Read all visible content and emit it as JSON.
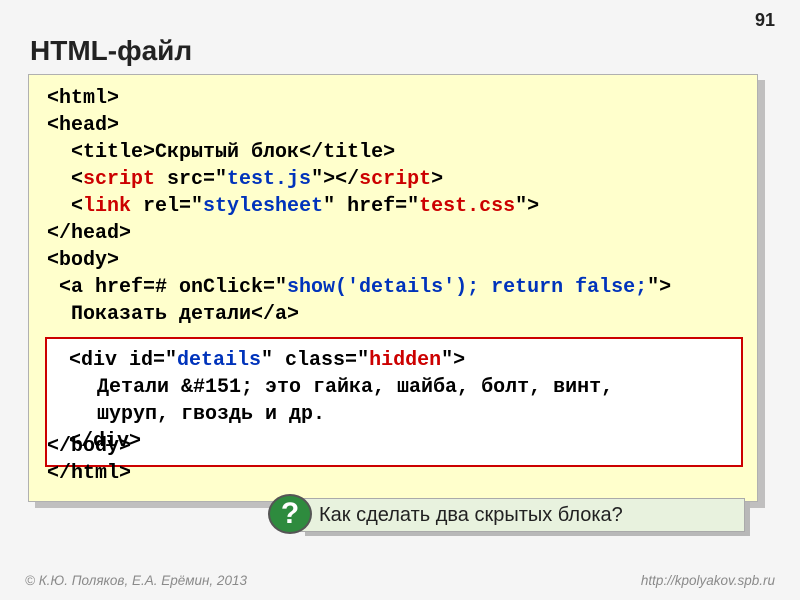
{
  "page_number": "91",
  "title": "HTML-файл",
  "code": {
    "l1": "<html>",
    "l2": "<head>",
    "l3a": "  <title>",
    "l3b": "Скрытый блок",
    "l3c": "</title>",
    "l4a": "  <",
    "l4b": "script",
    "l4c": " src=\"",
    "l4d": "test.js",
    "l4e": "\"></",
    "l4f": "script",
    "l4g": ">",
    "l5a": "  <",
    "l5b": "link",
    "l5c": " rel=\"",
    "l5d": "stylesheet",
    "l5e": "\" href=\"",
    "l5f": "test.css",
    "l5g": "\">",
    "l6": "</head>",
    "l7": "<body>",
    "l8a": " <a href=# onClick=\"",
    "l8b": "show('details'); return false;",
    "l8c": "\">",
    "l9": "  Показать детали</a>",
    "l10": "</body>",
    "l11": "</html>"
  },
  "inner": {
    "i1a": "<div id=\"",
    "i1b": "details",
    "i1c": "\" class=\"",
    "i1d": "hidden",
    "i1e": "\">",
    "i2": "Детали &#151; это гайка, шайба, болт, винт,",
    "i3": "шуруп, гвоздь и др.",
    "i4": "</div>"
  },
  "question_mark": "?",
  "question_text": "Как сделать два скрытых блока?",
  "footer_left": "© К.Ю. Поляков, Е.А. Ерёмин, 2013",
  "footer_right": "http://kpolyakov.spb.ru"
}
